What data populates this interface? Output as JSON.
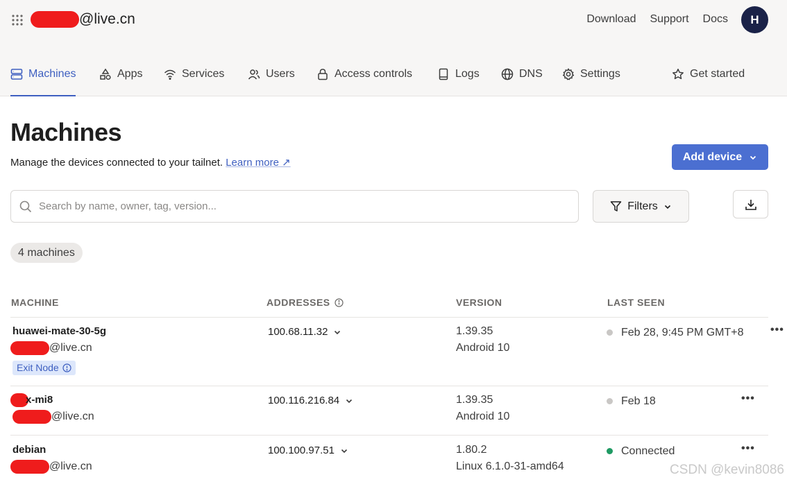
{
  "header": {
    "account_suffix": "@live.cn",
    "links": [
      "Download",
      "Support",
      "Docs"
    ],
    "avatar_initial": "H"
  },
  "nav": {
    "items": [
      {
        "label": "Machines",
        "icon": "server-icon"
      },
      {
        "label": "Apps",
        "icon": "apps-icon"
      },
      {
        "label": "Services",
        "icon": "wifi-icon"
      },
      {
        "label": "Users",
        "icon": "users-icon"
      },
      {
        "label": "Access controls",
        "icon": "lock-icon"
      },
      {
        "label": "Logs",
        "icon": "book-icon"
      },
      {
        "label": "DNS",
        "icon": "globe-icon"
      },
      {
        "label": "Settings",
        "icon": "gear-icon"
      },
      {
        "label": "Get started",
        "icon": "star-icon"
      }
    ],
    "active": "Machines"
  },
  "page": {
    "title": "Machines",
    "subtitle": "Manage the devices connected to your tailnet.",
    "learn_more": "Learn more ↗",
    "add_device": "Add device"
  },
  "search": {
    "placeholder": "Search by name, owner, tag, version...",
    "value": ""
  },
  "filters": {
    "label": "Filters"
  },
  "count_label": "4 machines",
  "table": {
    "headers": [
      "MACHINE",
      "ADDRESSES",
      "VERSION",
      "LAST SEEN"
    ],
    "rows": [
      {
        "name": "huawei-mate-30-5g",
        "owner_suffix": "@live.cn",
        "badge": "Exit Node",
        "address": "100.68.11.32",
        "version": "1.39.35",
        "os": "Android 10",
        "last_seen": "Feb 28, 9:45 PM GMT+8",
        "status": "offline"
      },
      {
        "name": "x-mi8",
        "owner_suffix": "@live.cn",
        "address": "100.116.216.84",
        "version": "1.39.35",
        "os": "Android 10",
        "last_seen": "Feb 18",
        "status": "offline"
      },
      {
        "name": "debian",
        "owner_suffix": "@live.cn",
        "address": "100.100.97.51",
        "version": "1.80.2",
        "os": "Linux 6.1.0-31-amd64",
        "last_seen": "Connected",
        "status": "online"
      }
    ]
  },
  "colors": {
    "accent": "#3e5fc0",
    "primary_button": "#4b6fd1",
    "online": "#1f9a63",
    "offline": "#c9c7c5",
    "avatar": "#1a2248"
  },
  "watermark": "CSDN @kevin8086"
}
